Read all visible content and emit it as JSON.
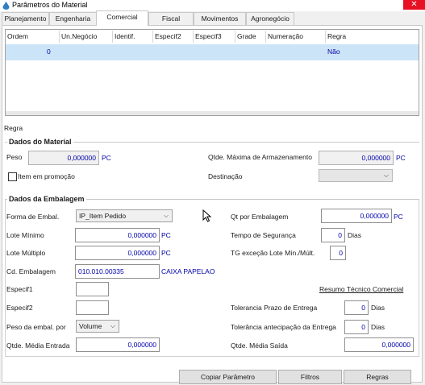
{
  "window": {
    "title": "Parâmetros do Material",
    "close_glyph": "✕"
  },
  "tabs": [
    {
      "label": "Planejamento"
    },
    {
      "label": "Engenharia"
    },
    {
      "label": "Comercial"
    },
    {
      "label": "Fiscal"
    },
    {
      "label": "Movimentos"
    },
    {
      "label": "Agronegócio"
    }
  ],
  "active_tab": "Comercial",
  "grid": {
    "columns": [
      "Ordem",
      "Un.Negócio",
      "Identif.",
      "Especif2",
      "Especif3",
      "Grade",
      "Numeração",
      "Regra"
    ],
    "rows": [
      {
        "ordem": "0",
        "regra": "Não"
      }
    ]
  },
  "regra_label": "Regra",
  "dados_material": {
    "title": "Dados do Material",
    "peso_label": "Peso",
    "peso_value": "0,000000",
    "peso_unit": "PC",
    "qtde_max_label": "Qtde. Máxima de Armazenamento",
    "qtde_max_value": "0,000000",
    "qtde_max_unit": "PC",
    "item_promocao_label": "Item em promoção",
    "item_promocao_checked": false,
    "destinacao_label": "Destinação",
    "destinacao_value": ""
  },
  "dados_embalagem": {
    "title": "Dados da Embalagem",
    "forma_label": "Forma de Embal.",
    "forma_value": "IP_Item Pedido",
    "qt_por_emb_label": "Qt por Embalagem",
    "qt_por_emb_value": "0,000000",
    "qt_por_emb_unit": "PC",
    "lote_min_label": "Lote Mínimo",
    "lote_min_value": "0,000000",
    "lote_min_unit": "PC",
    "tempo_seg_label": "Tempo de Segurança",
    "tempo_seg_value": "0",
    "tempo_seg_unit": "Dias",
    "lote_mult_label": "Lote Múltiplo",
    "lote_mult_value": "0,000000",
    "lote_mult_unit": "PC",
    "tg_excecao_label": "TG exceção Lote Mín./Múlt.",
    "tg_excecao_value": "0",
    "cd_emb_label": "Cd. Embalagem",
    "cd_emb_value": "010.010.00335",
    "cd_emb_desc": "CAIXA PAPELAO",
    "especif1_label": "Especif1",
    "especif1_value": "",
    "resumo_link": "Resumo Técnico Comercial",
    "especif2_label": "Especif2",
    "especif2_value": "",
    "tol_prazo_label": "Tolerancia Prazo de Entrega",
    "tol_prazo_value": "0",
    "tol_prazo_unit": "Dias",
    "peso_emb_label": "Peso da embal. por",
    "peso_emb_value": "Volume",
    "tol_antec_label": "Tolerância antecipação da Entrega",
    "tol_antec_value": "0",
    "tol_antec_unit": "Dias",
    "qtde_media_entrada_label": "Qtde. Média Entrada",
    "qtde_media_entrada_value": "0,000000",
    "qtde_media_saida_label": "Qtde. Média Saída",
    "qtde_media_saida_value": "0,000000"
  },
  "buttons": {
    "copiar": "Copiar Parâmetro",
    "filtros": "Filtros",
    "regras": "Regras"
  }
}
